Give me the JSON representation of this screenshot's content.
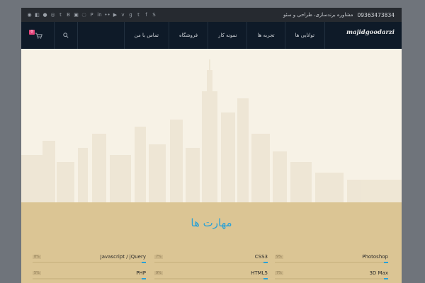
{
  "topbar": {
    "phone": "09363473834",
    "tagline": "مشاوره برندسازی، طراحی و سئو",
    "social_icons": [
      "rss-icon",
      "delicious-icon",
      "github-icon",
      "skype-alt-icon",
      "tumblr-icon",
      "behance-icon",
      "instagram-icon",
      "dribbble-icon",
      "pinterest-icon",
      "linkedin-icon",
      "flickr-icon",
      "youtube-icon",
      "vimeo-icon",
      "google-plus-icon",
      "twitter-icon",
      "facebook-icon",
      "skype-icon"
    ]
  },
  "nav": {
    "logo": "majidgoodarzi",
    "items": [
      "توانایی ها",
      "تجربه ها",
      "نمونه کار",
      "فروشگاه",
      "تماس با من"
    ],
    "cart_count": "0"
  },
  "skills": {
    "heading": "مهارت ها",
    "items": [
      {
        "name": "Photoshop",
        "pct": "9%"
      },
      {
        "name": "CSS3",
        "pct": "7%"
      },
      {
        "name": "Javascript / jQuery",
        "pct": "8%"
      },
      {
        "name": "3D Max",
        "pct": "7%"
      },
      {
        "name": "HTML5",
        "pct": "9%"
      },
      {
        "name": "PHP",
        "pct": "5%"
      }
    ]
  },
  "colors": {
    "accent": "#2aa1d6",
    "nav_bg": "#0e1a28",
    "topbar_bg": "#262a30",
    "skills_bg": "#dbc594",
    "badge": "#e6457c"
  }
}
